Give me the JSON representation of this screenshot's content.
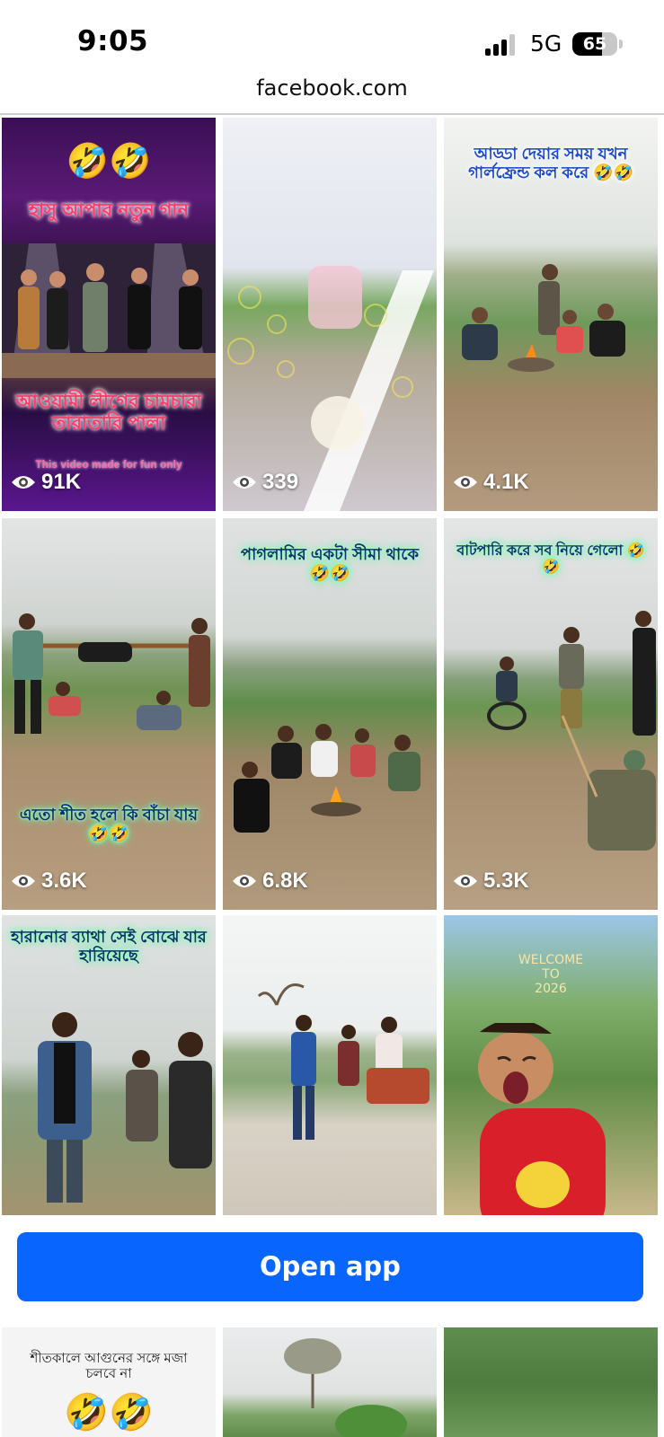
{
  "status_bar": {
    "time": "9:05",
    "network": "5G",
    "battery": "65",
    "battery_level": 0.65
  },
  "browser": {
    "url": "facebook.com"
  },
  "grid": {
    "tiles": [
      {
        "views": "91K",
        "title_emoji": "🤣🤣",
        "title": "হাসু আপার নতুন গান",
        "caption": "আওয়ামী লীগের চামচারা তারাতারি পালা",
        "footnote": "This video made for fun only"
      },
      {
        "views": "339"
      },
      {
        "views": "4.1K",
        "caption": "আড্ডা দেয়ার সময় যখন গার্লফ্রেন্ড কল করে 🤣🤣"
      },
      {
        "views": "3.6K",
        "caption": "এতো শীত হলে কি বাঁচা যায় 🤣🤣"
      },
      {
        "views": "6.8K",
        "caption": "পাগলামির একটা সীমা থাকে 🤣🤣"
      },
      {
        "views": "5.3K",
        "caption": "বাটপারি করে সব নিয়ে গেলো 🤣🤣"
      },
      {
        "caption": "হারানোর ব্যাথা সেই বোঝে যার হারিয়েছে"
      },
      {},
      {
        "caption_lines": [
          "WELCOME",
          "TO",
          "2026"
        ]
      }
    ],
    "bottom_tiles": [
      {
        "caption": "শীতকালে আগুনের সঙ্গে মজা চলবে না",
        "emoji": "🤣🤣"
      },
      {},
      {}
    ]
  },
  "open_app": {
    "label": "Open app"
  },
  "colors": {
    "accent": "#0866ff"
  },
  "icons": [
    "eye-icon",
    "signal-icon",
    "battery-icon"
  ]
}
